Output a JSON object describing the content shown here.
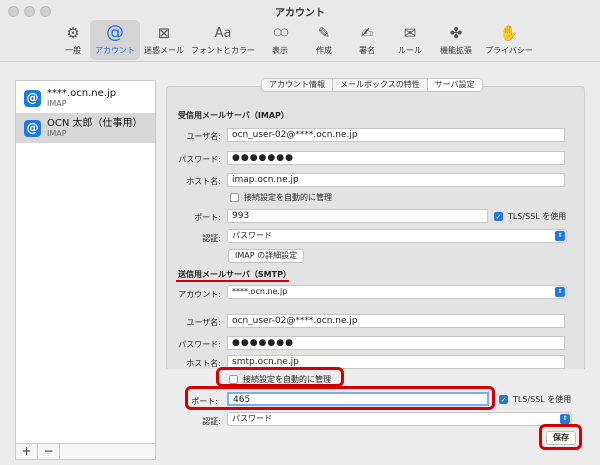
{
  "window": {
    "title": "アカウント"
  },
  "toolbar": {
    "items": [
      {
        "label": "一般",
        "icon": "gear-icon",
        "glyph": "⚙"
      },
      {
        "label": "アカウント",
        "icon": "at-icon",
        "glyph": "@"
      },
      {
        "label": "迷惑メール",
        "icon": "junk-mail-icon",
        "glyph": "⊠"
      },
      {
        "label": "フォントとカラー",
        "icon": "font-icon",
        "glyph": "Aa"
      },
      {
        "label": "表示",
        "icon": "glasses-icon",
        "glyph": "○○"
      },
      {
        "label": "作成",
        "icon": "compose-icon",
        "glyph": "✎"
      },
      {
        "label": "署名",
        "icon": "signature-icon",
        "glyph": "✍"
      },
      {
        "label": "ルール",
        "icon": "rules-icon",
        "glyph": "✉"
      },
      {
        "label": "機能拡張",
        "icon": "extension-icon",
        "glyph": "✤"
      },
      {
        "label": "プライバシー",
        "icon": "privacy-hand-icon",
        "glyph": "✋"
      }
    ],
    "active_index": 1
  },
  "sidebar": {
    "accounts": [
      {
        "name": "****.ocn.ne.jp",
        "type": "IMAP"
      },
      {
        "name": "OCN 太郎（仕事用）",
        "type": "IMAP"
      }
    ],
    "add_label": "+",
    "remove_label": "−"
  },
  "tabs": [
    "アカウント情報",
    "メールボックスの特性",
    "サーバ設定"
  ],
  "incoming": {
    "title": "受信用メールサーバ（IMAP）",
    "username_label": "ユーザ名:",
    "username": "ocn_user-02@****.ocn.ne.jp",
    "password_label": "パスワード:",
    "password": "●●●●●●●",
    "host_label": "ホスト名:",
    "host": "imap.ocn.ne.jp",
    "auto_manage_label": "接続設定を自動的に管理",
    "port_label": "ポート:",
    "port": "993",
    "tls_label": "TLS/SSL を使用",
    "auth_label": "認証:",
    "auth": "パスワード",
    "advanced_button": "IMAP の詳細設定"
  },
  "outgoing": {
    "title": "送信用メールサーバ（SMTP）",
    "account_label": "アカウント:",
    "account": "****.ocn.ne.jp",
    "username_label": "ユーザ名:",
    "username": "ocn_user-02@****.ocn.ne.jp",
    "password_label": "パスワード:",
    "password": "●●●●●●●",
    "host_label": "ホスト名:",
    "host": "smtp.ocn.ne.jp",
    "auto_manage_label": "接続設定を自動的に管理",
    "port_label": "ポート:",
    "port": "465",
    "tls_label": "TLS/SSL を使用",
    "auth_label": "認証:",
    "auth": "パスワード"
  },
  "save_button": "保存",
  "colors": {
    "accent": "#1f7ae0",
    "highlight": "#d40000"
  }
}
